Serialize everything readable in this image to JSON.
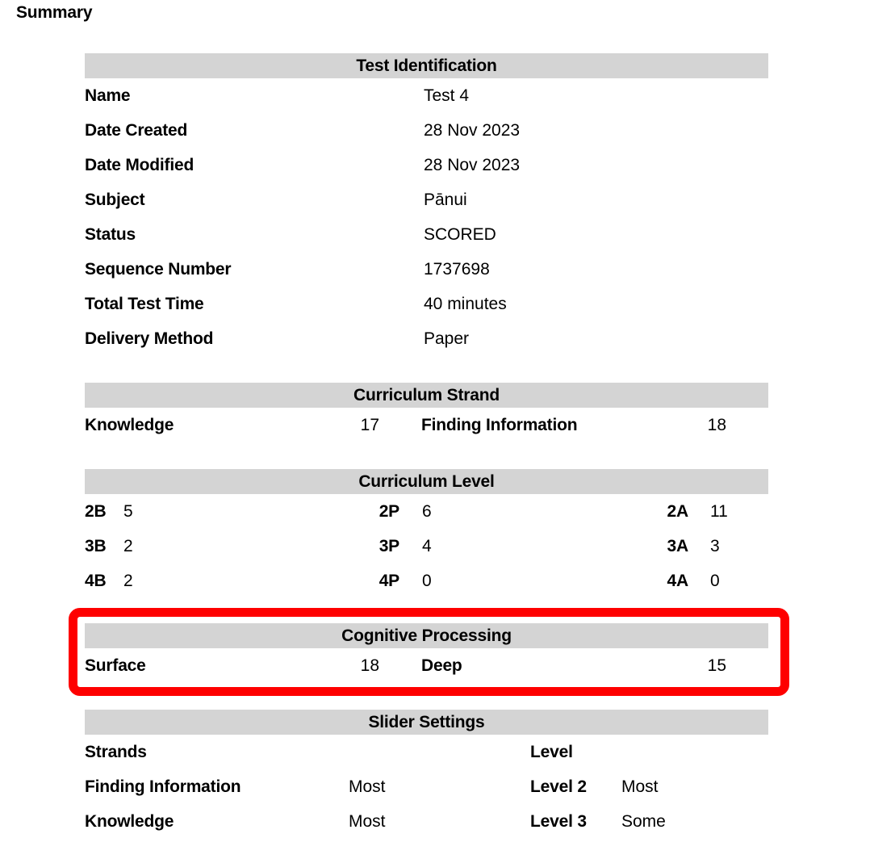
{
  "page": {
    "title": "Summary"
  },
  "sections": {
    "test_identification": {
      "header": "Test Identification",
      "rows": [
        {
          "label": "Name",
          "value": "Test 4"
        },
        {
          "label": "Date Created",
          "value": "28 Nov 2023"
        },
        {
          "label": "Date Modified",
          "value": "28 Nov 2023"
        },
        {
          "label": "Subject",
          "value": "Pānui"
        },
        {
          "label": "Status",
          "value": "SCORED"
        },
        {
          "label": "Sequence Number",
          "value": "1737698"
        },
        {
          "label": "Total Test Time",
          "value": "40 minutes"
        },
        {
          "label": "Delivery Method",
          "value": "Paper"
        }
      ]
    },
    "curriculum_strand": {
      "header": "Curriculum Strand",
      "rows": [
        {
          "label_a": "Knowledge",
          "value_a": "17",
          "label_b": "Finding Information",
          "value_b": "18"
        }
      ]
    },
    "curriculum_level": {
      "header": "Curriculum Level",
      "rows": [
        {
          "l1": "2B",
          "v1": "5",
          "l2": "2P",
          "v2": "6",
          "l3": "2A",
          "v3": "11"
        },
        {
          "l1": "3B",
          "v1": "2",
          "l2": "3P",
          "v2": "4",
          "l3": "3A",
          "v3": "3"
        },
        {
          "l1": "4B",
          "v1": "2",
          "l2": "4P",
          "v2": "0",
          "l3": "4A",
          "v3": "0"
        }
      ]
    },
    "cognitive_processing": {
      "header": "Cognitive Processing",
      "highlighted": true,
      "rows": [
        {
          "label_a": "Surface",
          "value_a": "18",
          "label_b": "Deep",
          "value_b": "15"
        }
      ]
    },
    "slider_settings": {
      "header": "Slider Settings",
      "rows": [
        {
          "strand_label": "Strands",
          "strand_value": "",
          "level_label": "Level",
          "level_value": ""
        },
        {
          "strand_label": "Finding Information",
          "strand_value": "Most",
          "level_label": "Level 2",
          "level_value": "Most"
        },
        {
          "strand_label": "Knowledge",
          "strand_value": "Most",
          "level_label": "Level 3",
          "level_value": "Some"
        }
      ]
    }
  },
  "colors": {
    "header_band": "#d4d4d4",
    "highlight": "#fe0000",
    "text": "#000000",
    "background": "#ffffff"
  }
}
